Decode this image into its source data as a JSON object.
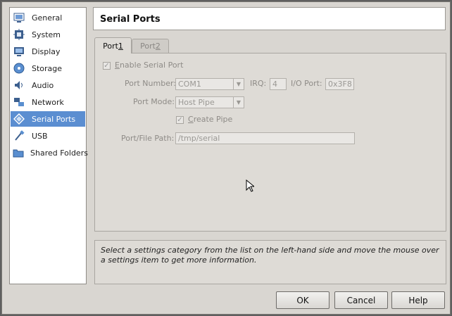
{
  "categories": [
    {
      "label": "General",
      "icon": "general-icon"
    },
    {
      "label": "System",
      "icon": "system-icon"
    },
    {
      "label": "Display",
      "icon": "display-icon"
    },
    {
      "label": "Storage",
      "icon": "storage-icon"
    },
    {
      "label": "Audio",
      "icon": "audio-icon"
    },
    {
      "label": "Network",
      "icon": "network-icon"
    },
    {
      "label": "Serial Ports",
      "icon": "serial-ports-icon",
      "selected": true
    },
    {
      "label": "USB",
      "icon": "usb-icon"
    },
    {
      "label": "Shared Folders",
      "icon": "shared-folders-icon"
    }
  ],
  "header": {
    "title": "Serial Ports"
  },
  "tabs": [
    {
      "label_pre": "Port ",
      "label_u": "1",
      "active": true
    },
    {
      "label_pre": "Port ",
      "label_u": "2",
      "active": false
    }
  ],
  "form": {
    "enable_label_u": "E",
    "enable_label_rest": "nable Serial Port",
    "enable_checked": true,
    "port_number_label": "Port Number:",
    "port_number_value": "COM1",
    "irq_label": "IRQ:",
    "irq_value": "4",
    "io_port_label": "I/O Port:",
    "io_port_value": "0x3F8",
    "port_mode_label": "Port Mode:",
    "port_mode_value": "Host Pipe",
    "create_pipe_label_u": "C",
    "create_pipe_label_rest": "reate Pipe",
    "create_pipe_checked": true,
    "path_label": "Port/File Path:",
    "path_value": "/tmp/serial"
  },
  "info_text": "Select a settings category from the list on the left-hand side and move the mouse over a settings item to get more information.",
  "buttons": {
    "ok": "OK",
    "cancel": "Cancel",
    "help": "Help"
  },
  "colors": {
    "selection": "#5b8ed1",
    "dialog_bg": "#d9d6d1"
  }
}
